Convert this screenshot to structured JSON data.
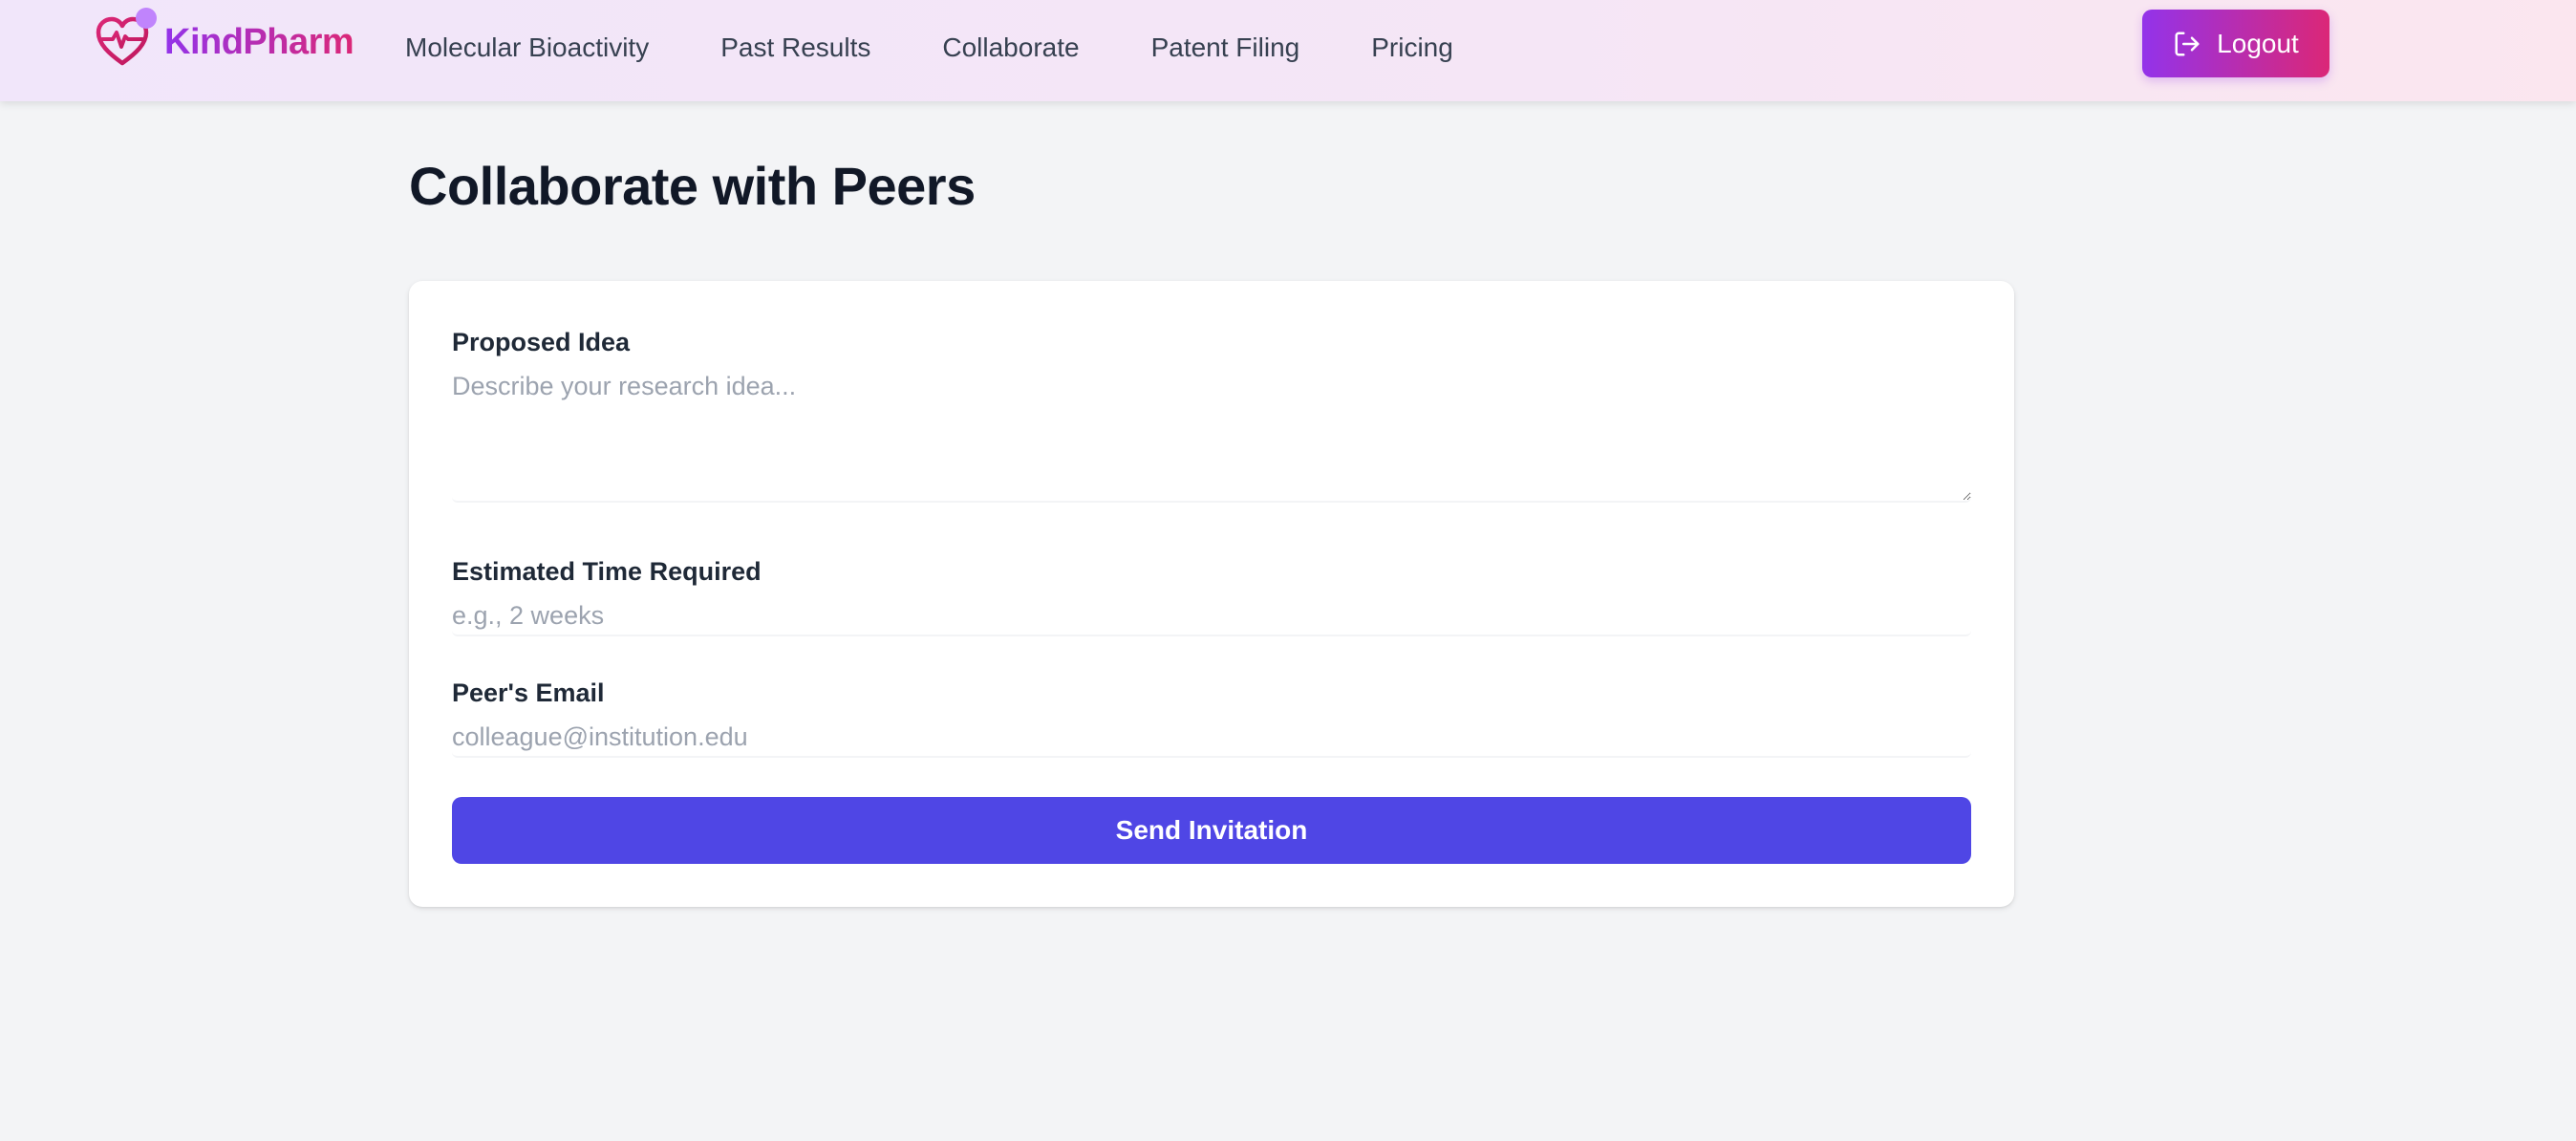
{
  "brand": {
    "name": "KindPharm",
    "icon": "heart-pulse-icon",
    "colors": {
      "gradient_start": "#9333ea",
      "gradient_end": "#db2777",
      "dot": "#c084fc"
    }
  },
  "nav": {
    "links": [
      {
        "label": "Molecular Bioactivity"
      },
      {
        "label": "Past Results"
      },
      {
        "label": "Collaborate"
      },
      {
        "label": "Patent Filing"
      },
      {
        "label": "Pricing"
      }
    ],
    "logout": {
      "label": "Logout",
      "icon": "logout-icon"
    }
  },
  "page": {
    "title": "Collaborate with Peers"
  },
  "form": {
    "idea": {
      "label": "Proposed Idea",
      "placeholder": "Describe your research idea...",
      "value": ""
    },
    "time": {
      "label": "Estimated Time Required",
      "placeholder": "e.g., 2 weeks",
      "value": ""
    },
    "email": {
      "label": "Peer's Email",
      "placeholder": "colleague@institution.edu",
      "value": ""
    },
    "submit_label": "Send Invitation"
  },
  "colors": {
    "primary_button": "#4f46e5",
    "page_background": "#f3f4f6",
    "card_background": "#ffffff"
  }
}
